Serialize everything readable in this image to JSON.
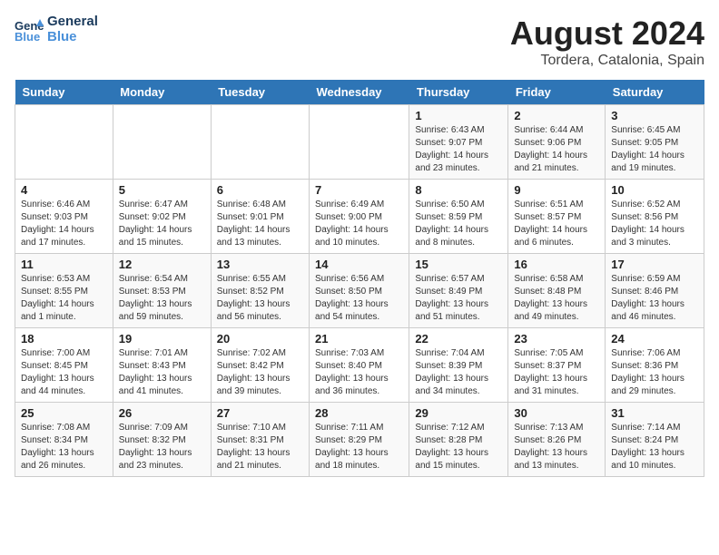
{
  "logo": {
    "line1": "General",
    "line2": "Blue"
  },
  "title": "August 2024",
  "subtitle": "Tordera, Catalonia, Spain",
  "days_of_week": [
    "Sunday",
    "Monday",
    "Tuesday",
    "Wednesday",
    "Thursday",
    "Friday",
    "Saturday"
  ],
  "weeks": [
    [
      {
        "day": "",
        "info": ""
      },
      {
        "day": "",
        "info": ""
      },
      {
        "day": "",
        "info": ""
      },
      {
        "day": "",
        "info": ""
      },
      {
        "day": "1",
        "info": "Sunrise: 6:43 AM\nSunset: 9:07 PM\nDaylight: 14 hours\nand 23 minutes."
      },
      {
        "day": "2",
        "info": "Sunrise: 6:44 AM\nSunset: 9:06 PM\nDaylight: 14 hours\nand 21 minutes."
      },
      {
        "day": "3",
        "info": "Sunrise: 6:45 AM\nSunset: 9:05 PM\nDaylight: 14 hours\nand 19 minutes."
      }
    ],
    [
      {
        "day": "4",
        "info": "Sunrise: 6:46 AM\nSunset: 9:03 PM\nDaylight: 14 hours\nand 17 minutes."
      },
      {
        "day": "5",
        "info": "Sunrise: 6:47 AM\nSunset: 9:02 PM\nDaylight: 14 hours\nand 15 minutes."
      },
      {
        "day": "6",
        "info": "Sunrise: 6:48 AM\nSunset: 9:01 PM\nDaylight: 14 hours\nand 13 minutes."
      },
      {
        "day": "7",
        "info": "Sunrise: 6:49 AM\nSunset: 9:00 PM\nDaylight: 14 hours\nand 10 minutes."
      },
      {
        "day": "8",
        "info": "Sunrise: 6:50 AM\nSunset: 8:59 PM\nDaylight: 14 hours\nand 8 minutes."
      },
      {
        "day": "9",
        "info": "Sunrise: 6:51 AM\nSunset: 8:57 PM\nDaylight: 14 hours\nand 6 minutes."
      },
      {
        "day": "10",
        "info": "Sunrise: 6:52 AM\nSunset: 8:56 PM\nDaylight: 14 hours\nand 3 minutes."
      }
    ],
    [
      {
        "day": "11",
        "info": "Sunrise: 6:53 AM\nSunset: 8:55 PM\nDaylight: 14 hours\nand 1 minute."
      },
      {
        "day": "12",
        "info": "Sunrise: 6:54 AM\nSunset: 8:53 PM\nDaylight: 13 hours\nand 59 minutes."
      },
      {
        "day": "13",
        "info": "Sunrise: 6:55 AM\nSunset: 8:52 PM\nDaylight: 13 hours\nand 56 minutes."
      },
      {
        "day": "14",
        "info": "Sunrise: 6:56 AM\nSunset: 8:50 PM\nDaylight: 13 hours\nand 54 minutes."
      },
      {
        "day": "15",
        "info": "Sunrise: 6:57 AM\nSunset: 8:49 PM\nDaylight: 13 hours\nand 51 minutes."
      },
      {
        "day": "16",
        "info": "Sunrise: 6:58 AM\nSunset: 8:48 PM\nDaylight: 13 hours\nand 49 minutes."
      },
      {
        "day": "17",
        "info": "Sunrise: 6:59 AM\nSunset: 8:46 PM\nDaylight: 13 hours\nand 46 minutes."
      }
    ],
    [
      {
        "day": "18",
        "info": "Sunrise: 7:00 AM\nSunset: 8:45 PM\nDaylight: 13 hours\nand 44 minutes."
      },
      {
        "day": "19",
        "info": "Sunrise: 7:01 AM\nSunset: 8:43 PM\nDaylight: 13 hours\nand 41 minutes."
      },
      {
        "day": "20",
        "info": "Sunrise: 7:02 AM\nSunset: 8:42 PM\nDaylight: 13 hours\nand 39 minutes."
      },
      {
        "day": "21",
        "info": "Sunrise: 7:03 AM\nSunset: 8:40 PM\nDaylight: 13 hours\nand 36 minutes."
      },
      {
        "day": "22",
        "info": "Sunrise: 7:04 AM\nSunset: 8:39 PM\nDaylight: 13 hours\nand 34 minutes."
      },
      {
        "day": "23",
        "info": "Sunrise: 7:05 AM\nSunset: 8:37 PM\nDaylight: 13 hours\nand 31 minutes."
      },
      {
        "day": "24",
        "info": "Sunrise: 7:06 AM\nSunset: 8:36 PM\nDaylight: 13 hours\nand 29 minutes."
      }
    ],
    [
      {
        "day": "25",
        "info": "Sunrise: 7:08 AM\nSunset: 8:34 PM\nDaylight: 13 hours\nand 26 minutes."
      },
      {
        "day": "26",
        "info": "Sunrise: 7:09 AM\nSunset: 8:32 PM\nDaylight: 13 hours\nand 23 minutes."
      },
      {
        "day": "27",
        "info": "Sunrise: 7:10 AM\nSunset: 8:31 PM\nDaylight: 13 hours\nand 21 minutes."
      },
      {
        "day": "28",
        "info": "Sunrise: 7:11 AM\nSunset: 8:29 PM\nDaylight: 13 hours\nand 18 minutes."
      },
      {
        "day": "29",
        "info": "Sunrise: 7:12 AM\nSunset: 8:28 PM\nDaylight: 13 hours\nand 15 minutes."
      },
      {
        "day": "30",
        "info": "Sunrise: 7:13 AM\nSunset: 8:26 PM\nDaylight: 13 hours\nand 13 minutes."
      },
      {
        "day": "31",
        "info": "Sunrise: 7:14 AM\nSunset: 8:24 PM\nDaylight: 13 hours\nand 10 minutes."
      }
    ]
  ]
}
